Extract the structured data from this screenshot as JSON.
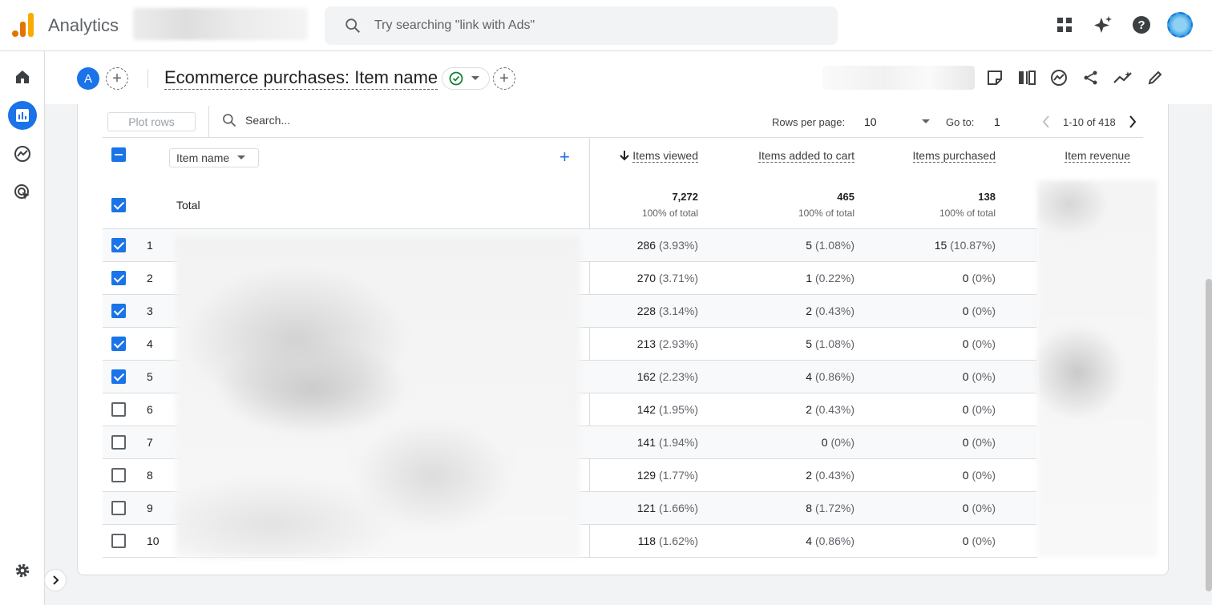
{
  "app": {
    "name": "Analytics"
  },
  "search": {
    "placeholder": "Try searching \"link with Ads\""
  },
  "top_icons": [
    "apps-grid-icon",
    "sparkle-icon",
    "help-icon",
    "account-avatar"
  ],
  "left_nav": [
    {
      "name": "home-icon",
      "active": false
    },
    {
      "name": "reports-icon",
      "active": true
    },
    {
      "name": "explore-icon",
      "active": false
    },
    {
      "name": "advertising-icon",
      "active": false
    }
  ],
  "report": {
    "comparison_chip": "A",
    "title": "Ecommerce purchases: Item name",
    "header_icons": [
      "customize-report-icon",
      "compare-icon",
      "insights-icon",
      "share-icon",
      "trend-icon",
      "edit-icon"
    ]
  },
  "table_toolbar": {
    "plot_rows": "Plot rows",
    "search_placeholder": "Search...",
    "rows_per_page_label": "Rows per page:",
    "rows_per_page_value": "10",
    "goto_label": "Go to:",
    "goto_value": "1",
    "range_text": "1-10 of 418"
  },
  "table": {
    "dimension": "Item name",
    "metric_headers": [
      "Items viewed",
      "Items added to cart",
      "Items purchased",
      "Item revenue"
    ],
    "sort_column": "Items viewed",
    "total": {
      "label": "Total",
      "items_viewed": "7,272",
      "items_added": "465",
      "items_purchased": "138",
      "pct": "100% of total"
    },
    "rows": [
      {
        "n": "1",
        "checked": true,
        "viewed": "286",
        "viewed_pct": "(3.93%)",
        "added": "5",
        "added_pct": "(1.08%)",
        "purchased": "15",
        "purchased_pct": "(10.87%)"
      },
      {
        "n": "2",
        "checked": true,
        "viewed": "270",
        "viewed_pct": "(3.71%)",
        "added": "1",
        "added_pct": "(0.22%)",
        "purchased": "0",
        "purchased_pct": "(0%)"
      },
      {
        "n": "3",
        "checked": true,
        "viewed": "228",
        "viewed_pct": "(3.14%)",
        "added": "2",
        "added_pct": "(0.43%)",
        "purchased": "0",
        "purchased_pct": "(0%)"
      },
      {
        "n": "4",
        "checked": true,
        "viewed": "213",
        "viewed_pct": "(2.93%)",
        "added": "5",
        "added_pct": "(1.08%)",
        "purchased": "0",
        "purchased_pct": "(0%)"
      },
      {
        "n": "5",
        "checked": true,
        "viewed": "162",
        "viewed_pct": "(2.23%)",
        "added": "4",
        "added_pct": "(0.86%)",
        "purchased": "0",
        "purchased_pct": "(0%)"
      },
      {
        "n": "6",
        "checked": false,
        "viewed": "142",
        "viewed_pct": "(1.95%)",
        "added": "2",
        "added_pct": "(0.43%)",
        "purchased": "0",
        "purchased_pct": "(0%)"
      },
      {
        "n": "7",
        "checked": false,
        "viewed": "141",
        "viewed_pct": "(1.94%)",
        "added": "0",
        "added_pct": "(0%)",
        "purchased": "0",
        "purchased_pct": "(0%)"
      },
      {
        "n": "8",
        "checked": false,
        "viewed": "129",
        "viewed_pct": "(1.77%)",
        "added": "2",
        "added_pct": "(0.43%)",
        "purchased": "0",
        "purchased_pct": "(0%)"
      },
      {
        "n": "9",
        "checked": false,
        "viewed": "121",
        "viewed_pct": "(1.66%)",
        "added": "8",
        "added_pct": "(1.72%)",
        "purchased": "0",
        "purchased_pct": "(0%)"
      },
      {
        "n": "10",
        "checked": false,
        "viewed": "118",
        "viewed_pct": "(1.62%)",
        "added": "4",
        "added_pct": "(0.86%)",
        "purchased": "0",
        "purchased_pct": "(0%)"
      }
    ]
  },
  "colors": {
    "accent": "#1a73e8",
    "logo_orange": "#e37400",
    "logo_yellow": "#f9ab00",
    "success": "#188038"
  }
}
